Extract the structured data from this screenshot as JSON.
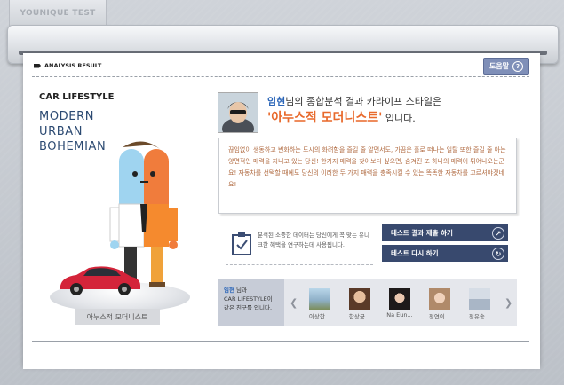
{
  "window": {
    "tab_label": "YOUNIQUE TEST"
  },
  "header": {
    "section_label": "ANALYSIS RESULT",
    "help_label": "도움말",
    "help_icon": "question-icon"
  },
  "left": {
    "title": "CAR LIFESTYLE",
    "style_lines": [
      "MODERN",
      "URBAN",
      "BOHEMIAN"
    ],
    "style_name": "아누스적 모더니스트"
  },
  "result": {
    "user_name": "임현",
    "intro_suffix": "님의 종합분석 결과 카라이프 스타일은",
    "style_name": "'아누스적 모더니스트'",
    "closing": "입니다.",
    "description": "끊임없이 생동하고 변화하는 도시의 화려함을 즐길 줄 알면서도, 가끔은 홀로 떠나는 일탈 또한 즐길 줄 아는 양면적인 매력을 지니고 있는 당신! 한가지 매력을 찾아보다 싶으면, 숨겨진 또 하나의 매력이 튀어나오는군요! 자동차를 선택할 때에도 당신의 이러한 두 가지 매력을 충족시킬 수 있는 똑똑한 자동차를 고르셔야겠네요!"
  },
  "info": {
    "text": "분석된 소중한 데이터는 당신에게 꼭 맞는 유니크한 혜택을 연구하는데 사용됩니다."
  },
  "actions": [
    {
      "label": "테스트 결과 제출 하기",
      "icon": "share-icon"
    },
    {
      "label": "테스트 다시 하기",
      "icon": "refresh-icon"
    }
  ],
  "friends": {
    "label_name": "임현",
    "label_line1": " 님과",
    "label_line2": "CAR LIFESTYLE이",
    "label_line3": "같은 친구를 입니다.",
    "items": [
      {
        "name": "이상한..."
      },
      {
        "name": "한상균..."
      },
      {
        "name": "Na Eun..."
      },
      {
        "name": "정연이..."
      },
      {
        "name": "정유송..."
      }
    ]
  },
  "colors": {
    "accent": "#e8692b",
    "link": "#2a65b8",
    "button": "#38496e",
    "help": "#7f8fb8"
  }
}
